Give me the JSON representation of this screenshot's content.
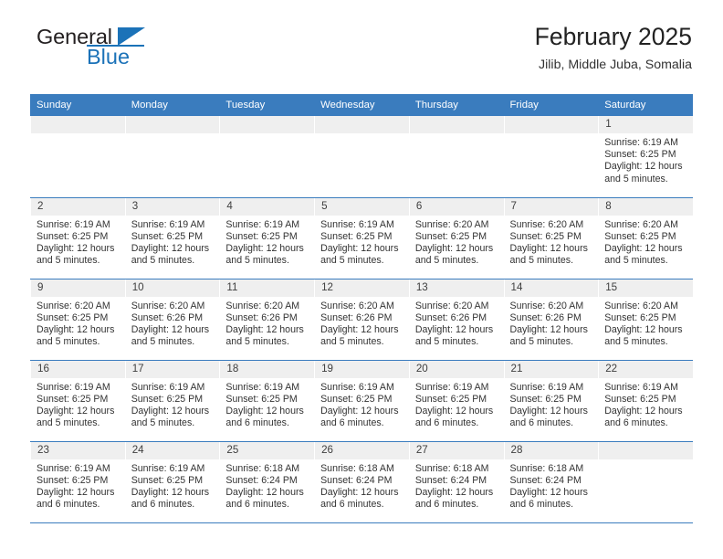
{
  "brand": {
    "word1": "General",
    "word2": "Blue",
    "logo_icon": "triangle-logo-icon",
    "accent_color": "#1b72b8"
  },
  "header": {
    "title": "February 2025",
    "subtitle": "Jilib, Middle Juba, Somalia"
  },
  "calendar": {
    "header_color": "#3a7cbe",
    "daynum_band_color": "#efefef",
    "weekdays": [
      "Sunday",
      "Monday",
      "Tuesday",
      "Wednesday",
      "Thursday",
      "Friday",
      "Saturday"
    ],
    "weeks": [
      [
        {
          "day": "",
          "empty": true
        },
        {
          "day": "",
          "empty": true
        },
        {
          "day": "",
          "empty": true
        },
        {
          "day": "",
          "empty": true
        },
        {
          "day": "",
          "empty": true
        },
        {
          "day": "",
          "empty": true
        },
        {
          "day": "1",
          "sunrise": "Sunrise: 6:19 AM",
          "sunset": "Sunset: 6:25 PM",
          "daylight1": "Daylight: 12 hours",
          "daylight2": "and 5 minutes."
        }
      ],
      [
        {
          "day": "2",
          "sunrise": "Sunrise: 6:19 AM",
          "sunset": "Sunset: 6:25 PM",
          "daylight1": "Daylight: 12 hours",
          "daylight2": "and 5 minutes."
        },
        {
          "day": "3",
          "sunrise": "Sunrise: 6:19 AM",
          "sunset": "Sunset: 6:25 PM",
          "daylight1": "Daylight: 12 hours",
          "daylight2": "and 5 minutes."
        },
        {
          "day": "4",
          "sunrise": "Sunrise: 6:19 AM",
          "sunset": "Sunset: 6:25 PM",
          "daylight1": "Daylight: 12 hours",
          "daylight2": "and 5 minutes."
        },
        {
          "day": "5",
          "sunrise": "Sunrise: 6:19 AM",
          "sunset": "Sunset: 6:25 PM",
          "daylight1": "Daylight: 12 hours",
          "daylight2": "and 5 minutes."
        },
        {
          "day": "6",
          "sunrise": "Sunrise: 6:20 AM",
          "sunset": "Sunset: 6:25 PM",
          "daylight1": "Daylight: 12 hours",
          "daylight2": "and 5 minutes."
        },
        {
          "day": "7",
          "sunrise": "Sunrise: 6:20 AM",
          "sunset": "Sunset: 6:25 PM",
          "daylight1": "Daylight: 12 hours",
          "daylight2": "and 5 minutes."
        },
        {
          "day": "8",
          "sunrise": "Sunrise: 6:20 AM",
          "sunset": "Sunset: 6:25 PM",
          "daylight1": "Daylight: 12 hours",
          "daylight2": "and 5 minutes."
        }
      ],
      [
        {
          "day": "9",
          "sunrise": "Sunrise: 6:20 AM",
          "sunset": "Sunset: 6:25 PM",
          "daylight1": "Daylight: 12 hours",
          "daylight2": "and 5 minutes."
        },
        {
          "day": "10",
          "sunrise": "Sunrise: 6:20 AM",
          "sunset": "Sunset: 6:26 PM",
          "daylight1": "Daylight: 12 hours",
          "daylight2": "and 5 minutes."
        },
        {
          "day": "11",
          "sunrise": "Sunrise: 6:20 AM",
          "sunset": "Sunset: 6:26 PM",
          "daylight1": "Daylight: 12 hours",
          "daylight2": "and 5 minutes."
        },
        {
          "day": "12",
          "sunrise": "Sunrise: 6:20 AM",
          "sunset": "Sunset: 6:26 PM",
          "daylight1": "Daylight: 12 hours",
          "daylight2": "and 5 minutes."
        },
        {
          "day": "13",
          "sunrise": "Sunrise: 6:20 AM",
          "sunset": "Sunset: 6:26 PM",
          "daylight1": "Daylight: 12 hours",
          "daylight2": "and 5 minutes."
        },
        {
          "day": "14",
          "sunrise": "Sunrise: 6:20 AM",
          "sunset": "Sunset: 6:26 PM",
          "daylight1": "Daylight: 12 hours",
          "daylight2": "and 5 minutes."
        },
        {
          "day": "15",
          "sunrise": "Sunrise: 6:20 AM",
          "sunset": "Sunset: 6:25 PM",
          "daylight1": "Daylight: 12 hours",
          "daylight2": "and 5 minutes."
        }
      ],
      [
        {
          "day": "16",
          "sunrise": "Sunrise: 6:19 AM",
          "sunset": "Sunset: 6:25 PM",
          "daylight1": "Daylight: 12 hours",
          "daylight2": "and 5 minutes."
        },
        {
          "day": "17",
          "sunrise": "Sunrise: 6:19 AM",
          "sunset": "Sunset: 6:25 PM",
          "daylight1": "Daylight: 12 hours",
          "daylight2": "and 5 minutes."
        },
        {
          "day": "18",
          "sunrise": "Sunrise: 6:19 AM",
          "sunset": "Sunset: 6:25 PM",
          "daylight1": "Daylight: 12 hours",
          "daylight2": "and 6 minutes."
        },
        {
          "day": "19",
          "sunrise": "Sunrise: 6:19 AM",
          "sunset": "Sunset: 6:25 PM",
          "daylight1": "Daylight: 12 hours",
          "daylight2": "and 6 minutes."
        },
        {
          "day": "20",
          "sunrise": "Sunrise: 6:19 AM",
          "sunset": "Sunset: 6:25 PM",
          "daylight1": "Daylight: 12 hours",
          "daylight2": "and 6 minutes."
        },
        {
          "day": "21",
          "sunrise": "Sunrise: 6:19 AM",
          "sunset": "Sunset: 6:25 PM",
          "daylight1": "Daylight: 12 hours",
          "daylight2": "and 6 minutes."
        },
        {
          "day": "22",
          "sunrise": "Sunrise: 6:19 AM",
          "sunset": "Sunset: 6:25 PM",
          "daylight1": "Daylight: 12 hours",
          "daylight2": "and 6 minutes."
        }
      ],
      [
        {
          "day": "23",
          "sunrise": "Sunrise: 6:19 AM",
          "sunset": "Sunset: 6:25 PM",
          "daylight1": "Daylight: 12 hours",
          "daylight2": "and 6 minutes."
        },
        {
          "day": "24",
          "sunrise": "Sunrise: 6:19 AM",
          "sunset": "Sunset: 6:25 PM",
          "daylight1": "Daylight: 12 hours",
          "daylight2": "and 6 minutes."
        },
        {
          "day": "25",
          "sunrise": "Sunrise: 6:18 AM",
          "sunset": "Sunset: 6:24 PM",
          "daylight1": "Daylight: 12 hours",
          "daylight2": "and 6 minutes."
        },
        {
          "day": "26",
          "sunrise": "Sunrise: 6:18 AM",
          "sunset": "Sunset: 6:24 PM",
          "daylight1": "Daylight: 12 hours",
          "daylight2": "and 6 minutes."
        },
        {
          "day": "27",
          "sunrise": "Sunrise: 6:18 AM",
          "sunset": "Sunset: 6:24 PM",
          "daylight1": "Daylight: 12 hours",
          "daylight2": "and 6 minutes."
        },
        {
          "day": "28",
          "sunrise": "Sunrise: 6:18 AM",
          "sunset": "Sunset: 6:24 PM",
          "daylight1": "Daylight: 12 hours",
          "daylight2": "and 6 minutes."
        },
        {
          "day": "",
          "empty": true
        }
      ]
    ]
  }
}
